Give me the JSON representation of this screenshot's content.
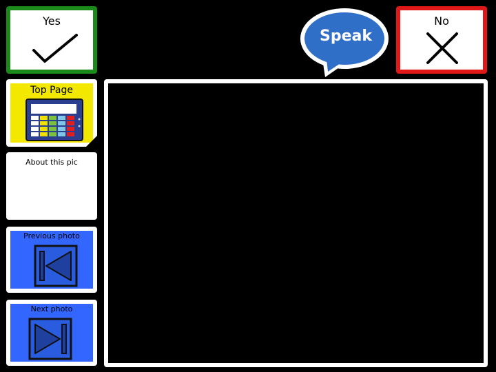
{
  "buttons": {
    "yes": "Yes",
    "no": "No",
    "speak": "Speak",
    "top_page": "Top Page",
    "about": "About this pic",
    "previous": "Previous photo",
    "next": "Next photo"
  },
  "icons": {
    "yes": "checkmark-icon",
    "no": "cross-icon",
    "top_page": "board-grid-icon",
    "previous": "skip-previous-icon",
    "next": "skip-next-icon"
  },
  "colors": {
    "yes_border": "#1a8a1a",
    "no_border": "#e01818",
    "speak_bubble": "#2f6fc7",
    "top_page_bg": "#f3e800",
    "nav_bg": "#3366ff"
  }
}
